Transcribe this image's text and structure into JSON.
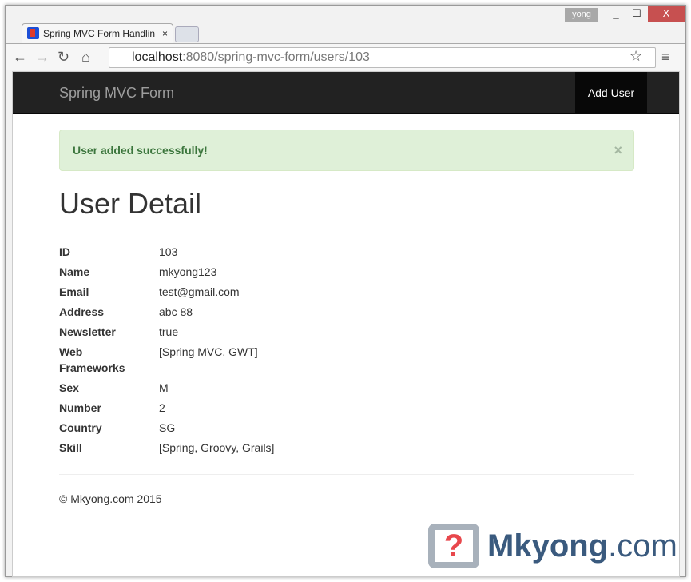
{
  "browser": {
    "user": "yong",
    "tab_title": "Spring MVC Form Handlin",
    "url_host": "localhost",
    "url_rest": ":8080/spring-mvc-form/users/103"
  },
  "nav": {
    "brand": "Spring MVC Form",
    "add_user": "Add User"
  },
  "alert": {
    "message": "User added successfully!",
    "close": "×"
  },
  "page_title": "User Detail",
  "details": [
    {
      "label": "ID",
      "value": "103"
    },
    {
      "label": "Name",
      "value": "mkyong123"
    },
    {
      "label": "Email",
      "value": "test@gmail.com"
    },
    {
      "label": "Address",
      "value": "abc 88"
    },
    {
      "label": "Newsletter",
      "value": "true"
    },
    {
      "label": "Web Frameworks",
      "value": "[Spring MVC, GWT]"
    },
    {
      "label": "Sex",
      "value": "M"
    },
    {
      "label": "Number",
      "value": "2"
    },
    {
      "label": "Country",
      "value": "SG"
    },
    {
      "label": "Skill",
      "value": "[Spring, Groovy, Grails]"
    }
  ],
  "footer": "© Mkyong.com 2015",
  "watermark": {
    "name": "Mkyong",
    "suffix": ".com",
    "mark": "?"
  }
}
